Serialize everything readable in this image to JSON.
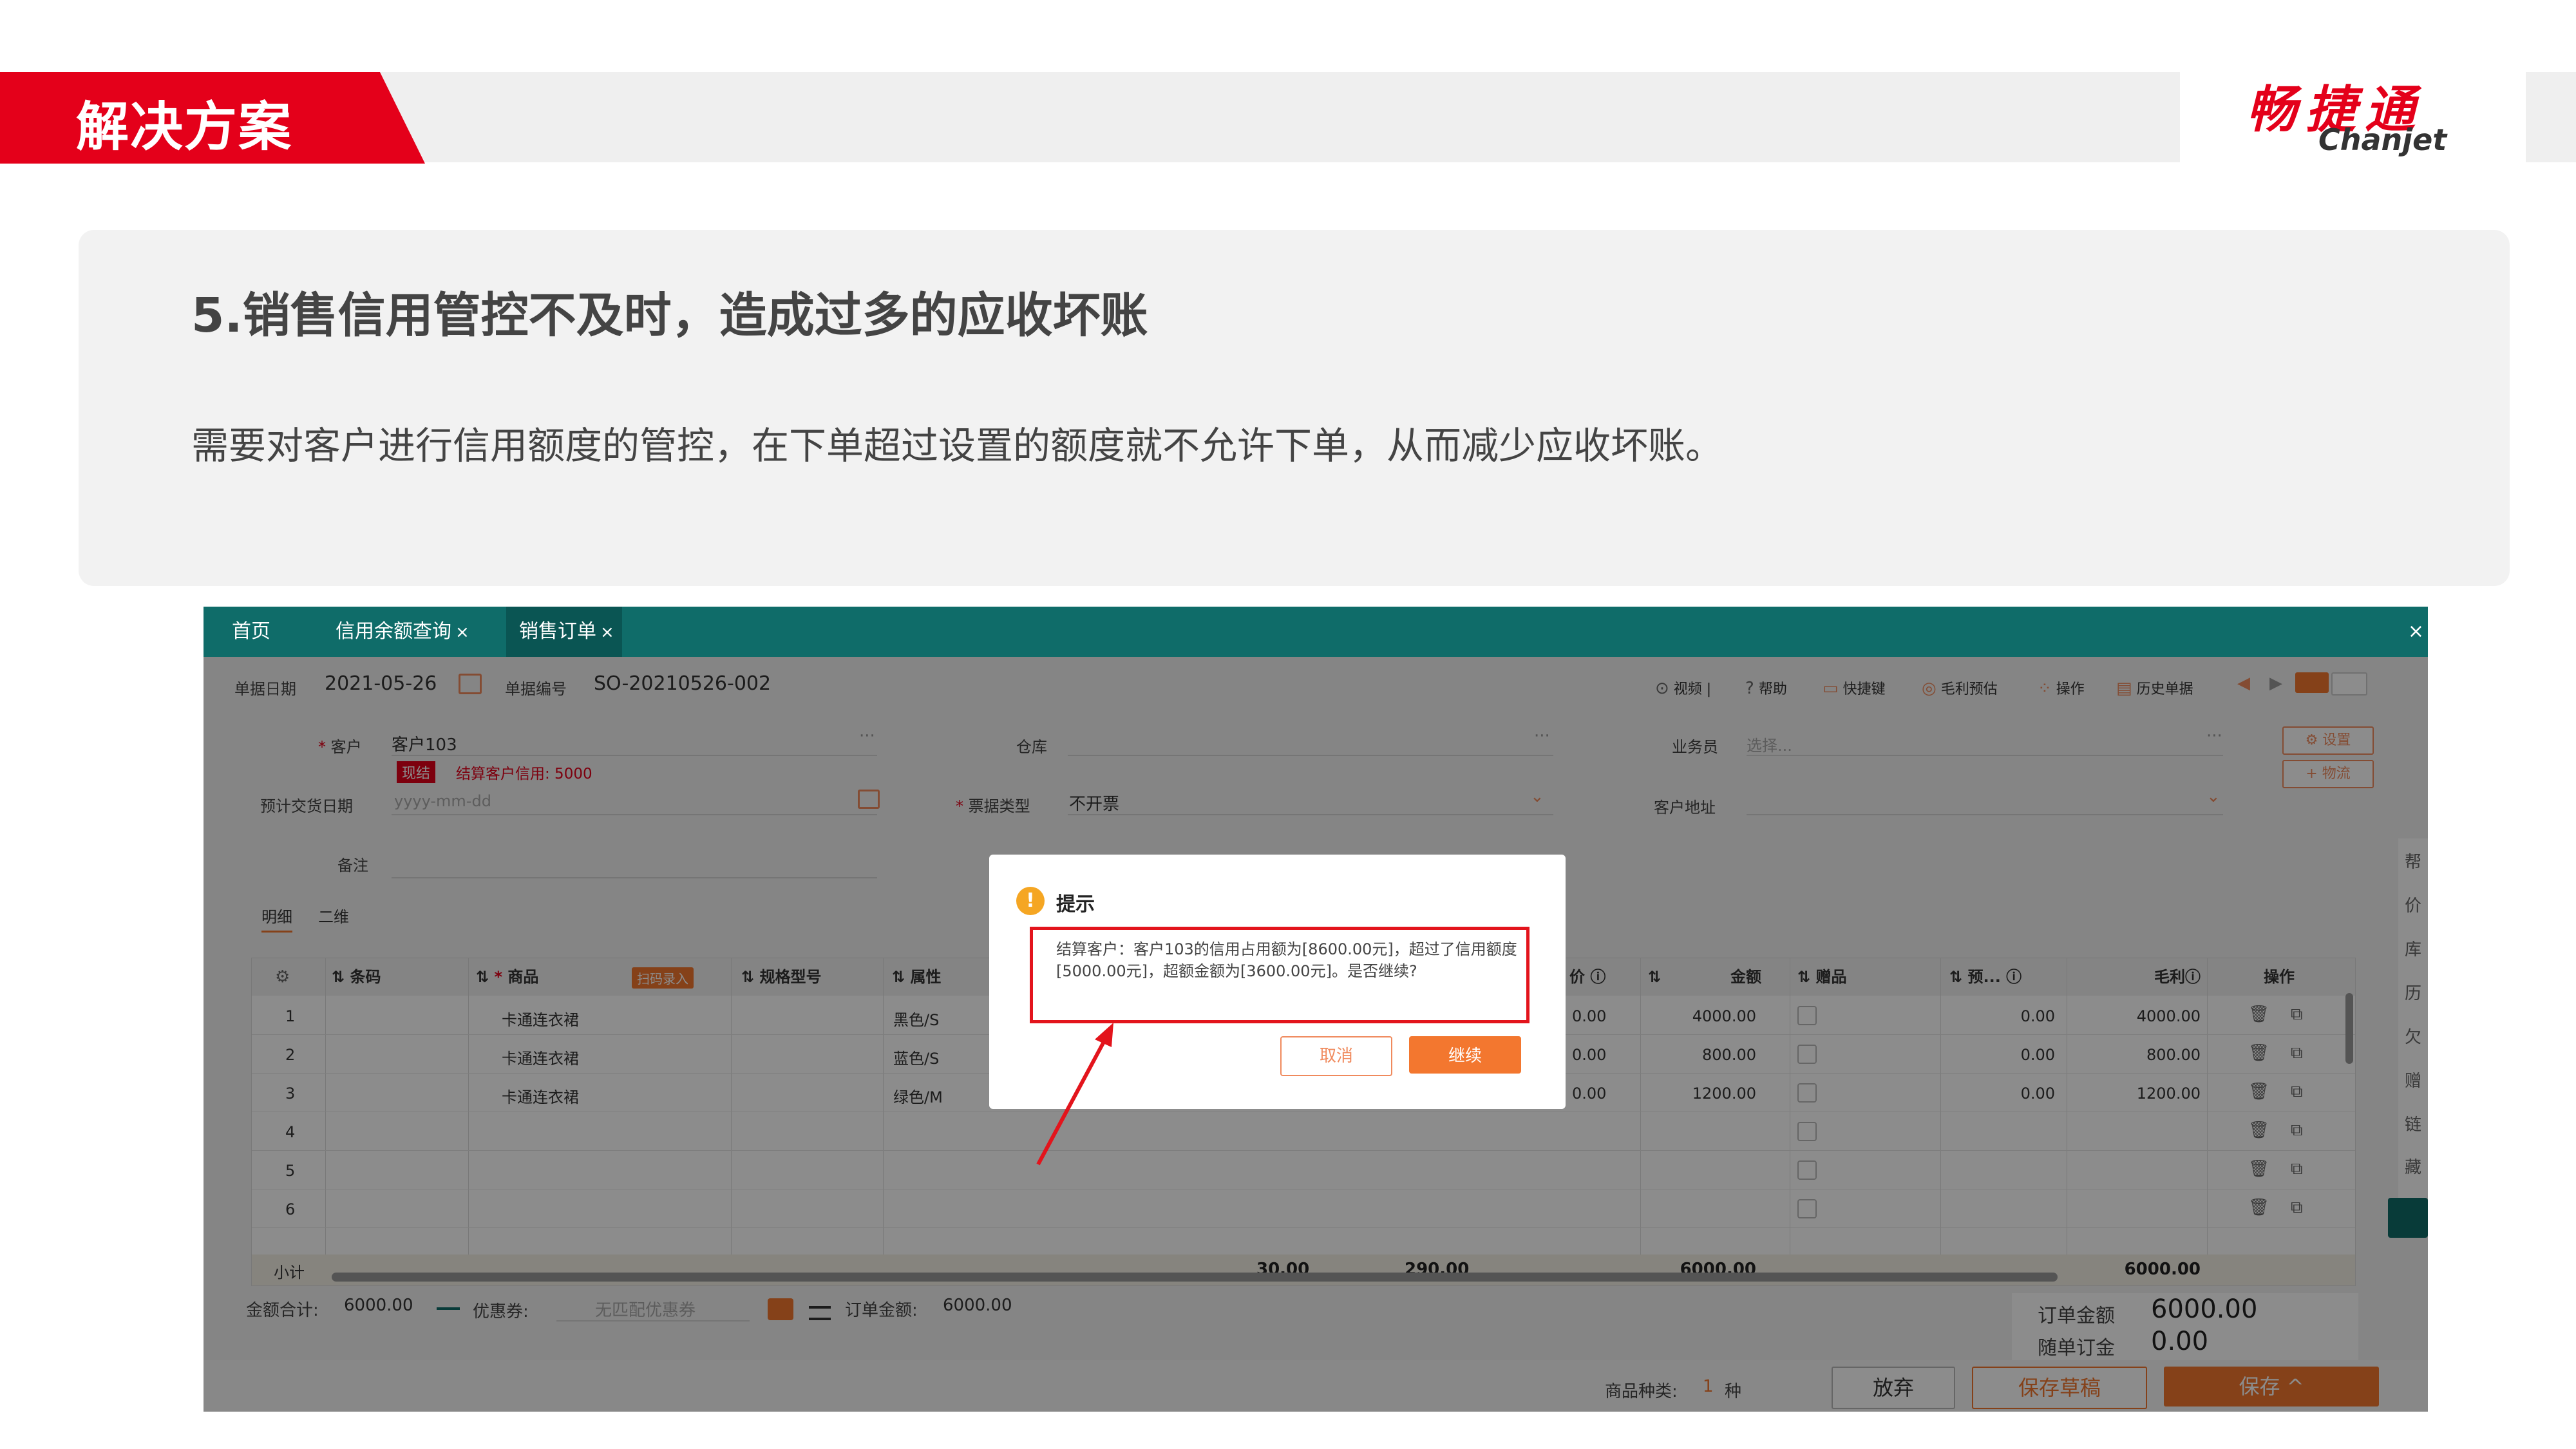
{
  "header": {
    "section_title": "解决方案",
    "logo_cn": "畅捷通",
    "logo_en": "Chanjet"
  },
  "card": {
    "title": "5.销售信用管控不及时，造成过多的应收坏账",
    "description": "需要对客户进行信用额度的管控，在下单超过设置的额度就不允许下单，从而减少应收坏账。"
  },
  "app": {
    "tabs": [
      {
        "label": "首页",
        "closable": false
      },
      {
        "label": "信用余额查询",
        "closable": true
      },
      {
        "label": "销售订单",
        "closable": true
      }
    ],
    "tab_close": "×",
    "window_close": "×",
    "doc_date_label": "单据日期",
    "doc_date_value": "2021-05-26",
    "doc_no_label": "单据编号",
    "doc_no_value": "SO-20210526-002",
    "toolbar": [
      "视频",
      "帮助",
      "快捷键",
      "毛利预估",
      "操作",
      "历史单据"
    ],
    "form": {
      "customer_label": "客户",
      "customer_value": "客户103",
      "settle_badge": "现结",
      "settle_info": "结算客户信用: 5000",
      "warehouse_label": "仓库",
      "salesman_label": "业务员",
      "salesman_placeholder": "选择...",
      "delivery_label": "预计交货日期",
      "delivery_placeholder": "yyyy-mm-dd",
      "invoice_label": "票据类型",
      "invoice_value": "不开票",
      "address_label": "客户地址",
      "remark_label": "备注",
      "settings_btn": "设置",
      "logistics_btn": "物流",
      "detail_tabs": [
        "明细",
        "二维"
      ]
    },
    "table": {
      "columns": [
        "条码",
        "商品",
        "规格型号",
        "属性",
        "价",
        "金额",
        "赠品",
        "预...",
        "毛利"
      ],
      "scan_badge": "扫码录入",
      "op_header": "操作",
      "rows": [
        {
          "no": "1",
          "product": "卡通连衣裙",
          "attr": "黑色/S",
          "price_tail": "0.00",
          "amount": "4000.00",
          "pre": "0.00",
          "profit": "4000.00"
        },
        {
          "no": "2",
          "product": "卡通连衣裙",
          "attr": "蓝色/S",
          "price_tail": "0.00",
          "amount": "800.00",
          "pre": "0.00",
          "profit": "800.00"
        },
        {
          "no": "3",
          "product": "卡通连衣裙",
          "attr": "绿色/M",
          "price_tail": "0.00",
          "amount": "1200.00",
          "pre": "0.00",
          "profit": "1200.00"
        },
        {
          "no": "4"
        },
        {
          "no": "5"
        },
        {
          "no": "6"
        }
      ],
      "subtotal_label": "小计",
      "subtotal_qty": "30.00",
      "subtotal_2": "290.00",
      "subtotal_amount": "6000.00",
      "subtotal_profit": "6000.00"
    },
    "summary": {
      "amount_label": "金额合计:",
      "amount_value": "6000.00",
      "coupon_label": "优惠券:",
      "coupon_value": "无匹配优惠券",
      "order_label": "订单金额:",
      "order_value": "6000.00",
      "order_amount_label": "订单金额",
      "order_amount_value": "6000.00",
      "with_order_label": "随单订金",
      "with_order_value": "0.00"
    },
    "footer": {
      "kinds_label": "商品种类:",
      "kinds_value": "1",
      "kinds_unit": "种",
      "discard": "放弃",
      "save_draft": "保存草稿",
      "save": "保存"
    },
    "side_icons": [
      "帮",
      "价",
      "库",
      "历",
      "欠",
      "赠",
      "链",
      "藏"
    ],
    "dialog": {
      "title": "提示",
      "message": "结算客户：客户103的信用占用额为[8600.00元]，超过了信用额度[5000.00元]，超额金额为[3600.00元]。是否继续?",
      "cancel": "取消",
      "continue": "继续"
    }
  },
  "colors": {
    "brand_red": "#e4001a",
    "teal": "#0f6c69",
    "orange": "#f3772f"
  }
}
